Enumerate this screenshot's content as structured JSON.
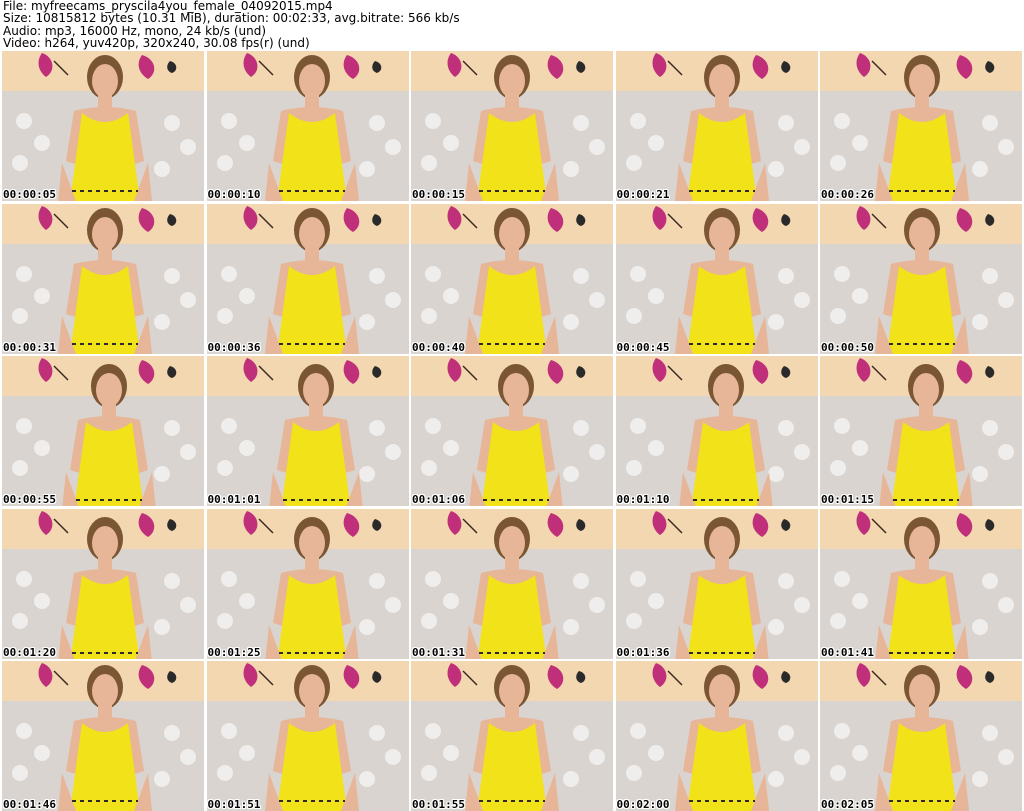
{
  "header": {
    "line1": "File: myfreecams_pryscila4you_female_04092015.mp4",
    "line2": "Size: 10815812 bytes (10.31 MiB), duration: 00:02:33, avg.bitrate: 566 kb/s",
    "line3": "Audio: mp3, 16000 Hz, mono, 24 kb/s (und)",
    "line4": "Video: h264, yuv420p, 320x240, 30.08 fps(r) (und)"
  },
  "thumbnails": [
    {
      "timestamp": "00:00:05"
    },
    {
      "timestamp": "00:00:10"
    },
    {
      "timestamp": "00:00:15"
    },
    {
      "timestamp": "00:00:21"
    },
    {
      "timestamp": "00:00:26"
    },
    {
      "timestamp": "00:00:31"
    },
    {
      "timestamp": "00:00:36"
    },
    {
      "timestamp": "00:00:40"
    },
    {
      "timestamp": "00:00:45"
    },
    {
      "timestamp": "00:00:50"
    },
    {
      "timestamp": "00:00:55"
    },
    {
      "timestamp": "00:01:01"
    },
    {
      "timestamp": "00:01:06"
    },
    {
      "timestamp": "00:01:10"
    },
    {
      "timestamp": "00:01:15"
    },
    {
      "timestamp": "00:01:20"
    },
    {
      "timestamp": "00:01:25"
    },
    {
      "timestamp": "00:01:31"
    },
    {
      "timestamp": "00:01:36"
    },
    {
      "timestamp": "00:01:41"
    },
    {
      "timestamp": "00:01:46"
    },
    {
      "timestamp": "00:01:51"
    },
    {
      "timestamp": "00:01:55"
    },
    {
      "timestamp": "00:02:00"
    },
    {
      "timestamp": "00:02:05"
    }
  ],
  "colors": {
    "wall": "#f3d7b0",
    "sofa": "#d9d4cf",
    "dress": "#f2e21a",
    "skin": "#e7b597",
    "hair": "#7a5634",
    "flower": "#c0307a"
  }
}
